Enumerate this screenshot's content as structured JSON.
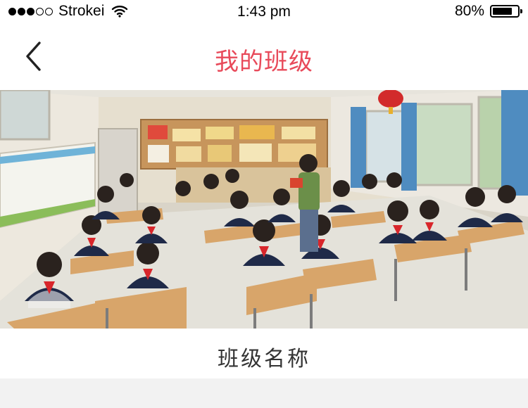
{
  "status_bar": {
    "carrier": "Strokei",
    "time": "1:43 pm",
    "battery": "80%",
    "battery_level": 0.8
  },
  "nav": {
    "title": "我的班级",
    "title_color": "#e84a5a",
    "back_icon": "chevron-left-icon"
  },
  "photo": {
    "icon": "classroom-photo"
  },
  "class_info": {
    "name": "班级名称"
  }
}
